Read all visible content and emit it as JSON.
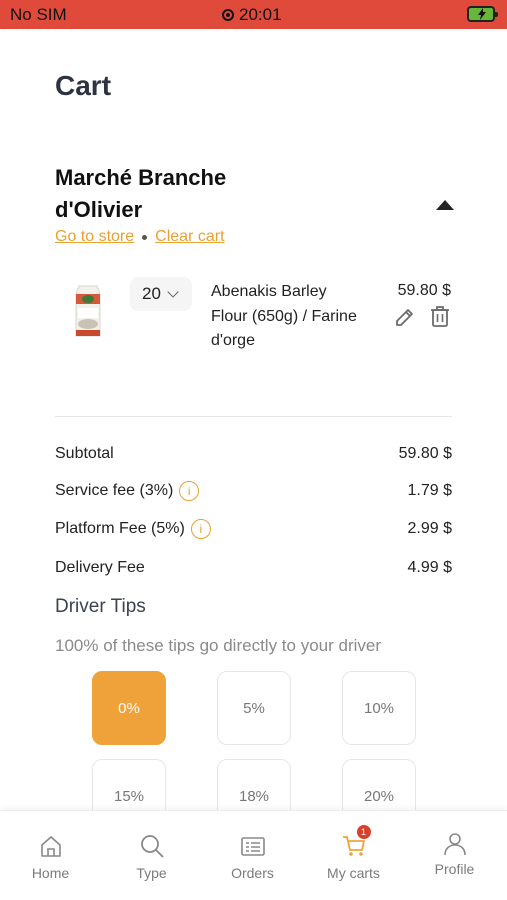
{
  "status_bar": {
    "carrier": "No SIM",
    "time": "20:01"
  },
  "page": {
    "title": "Cart"
  },
  "store": {
    "name": "Marché Branche d'Olivier",
    "go_to_store": "Go to store",
    "clear_cart": "Clear cart"
  },
  "cart_item": {
    "quantity": "20",
    "name": "Abenakis Barley Flour (650g) / Farine d'orge",
    "price": "59.80 $"
  },
  "summary": {
    "subtotal_label": "Subtotal",
    "subtotal_value": "59.80 $",
    "service_label": "Service fee (3%)",
    "service_value": "1.79 $",
    "platform_label": "Platform Fee (5%)",
    "platform_value": "2.99 $",
    "delivery_label": "Delivery Fee",
    "delivery_value": "4.99 $"
  },
  "tips": {
    "title": "Driver Tips",
    "description": "100% of these tips go directly to your driver",
    "options": [
      "0%",
      "5%",
      "10%",
      "15%",
      "18%",
      "20%"
    ],
    "selected": "0%"
  },
  "nav": {
    "home": "Home",
    "type": "Type",
    "orders": "Orders",
    "carts": "My carts",
    "carts_badge": "1",
    "profile": "Profile"
  },
  "colors": {
    "status_bar": "#e04a3a",
    "accent": "#f0a23a",
    "link": "#e8a033",
    "badge": "#d9412f"
  },
  "icons": [
    "record-icon",
    "battery-charging-icon",
    "collapse-arrow-icon",
    "chevron-down-icon",
    "edit-icon",
    "trash-icon",
    "info-icon",
    "home-icon",
    "search-icon",
    "orders-icon",
    "cart-icon",
    "profile-icon"
  ]
}
